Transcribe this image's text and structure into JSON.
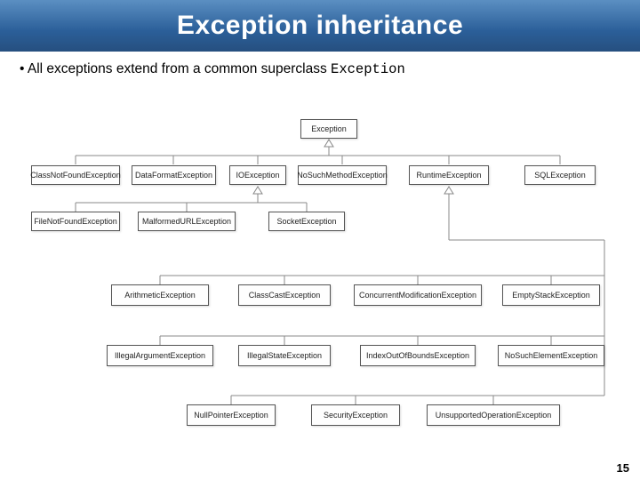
{
  "banner": {
    "title": "Exception inheritance"
  },
  "bullet": {
    "prefix": "• All exceptions extend from a common superclass ",
    "code": "Exception"
  },
  "root": {
    "label": "Exception"
  },
  "row1": {
    "0": "ClassNotFoundException",
    "1": "DataFormatException",
    "2": "IOException",
    "3": "NoSuchMethodException",
    "4": "RuntimeException",
    "5": "SQLException"
  },
  "row2": {
    "0": "FileNotFoundException",
    "1": "MalformedURLException",
    "2": "SocketException"
  },
  "row3": {
    "0": "ArithmeticException",
    "1": "ClassCastException",
    "2": "ConcurrentModificationException",
    "3": "EmptyStackException"
  },
  "row4": {
    "0": "IllegalArgumentException",
    "1": "IllegalStateException",
    "2": "IndexOutOfBoundsException",
    "3": "NoSuchElementException"
  },
  "row5": {
    "0": "NullPointerException",
    "1": "SecurityException",
    "2": "UnsupportedOperationException"
  },
  "page": {
    "num": "15"
  }
}
